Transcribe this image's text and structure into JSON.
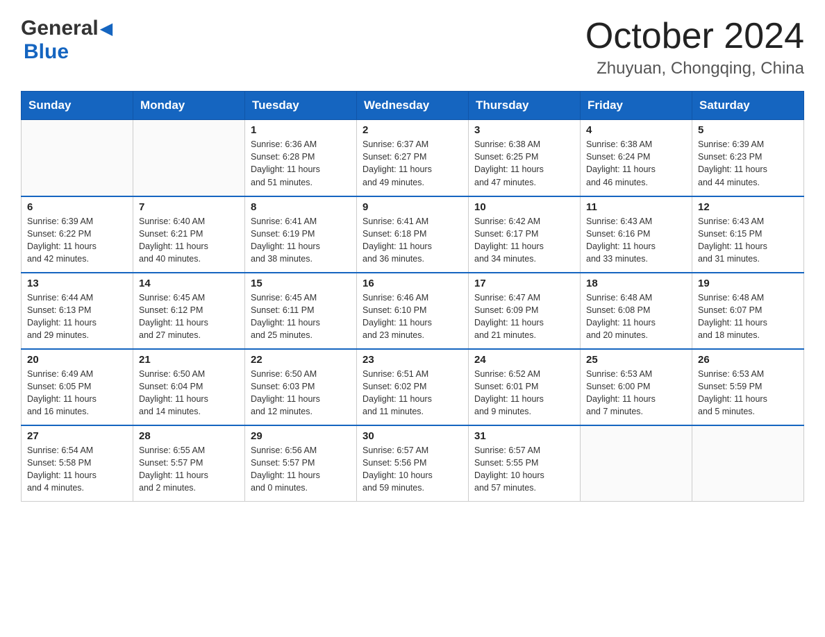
{
  "header": {
    "logo_general": "General",
    "logo_blue": "Blue",
    "month_title": "October 2024",
    "location": "Zhuyuan, Chongqing, China"
  },
  "weekdays": [
    "Sunday",
    "Monday",
    "Tuesday",
    "Wednesday",
    "Thursday",
    "Friday",
    "Saturday"
  ],
  "weeks": [
    {
      "days": [
        {
          "number": "",
          "info": ""
        },
        {
          "number": "",
          "info": ""
        },
        {
          "number": "1",
          "info": "Sunrise: 6:36 AM\nSunset: 6:28 PM\nDaylight: 11 hours\nand 51 minutes."
        },
        {
          "number": "2",
          "info": "Sunrise: 6:37 AM\nSunset: 6:27 PM\nDaylight: 11 hours\nand 49 minutes."
        },
        {
          "number": "3",
          "info": "Sunrise: 6:38 AM\nSunset: 6:25 PM\nDaylight: 11 hours\nand 47 minutes."
        },
        {
          "number": "4",
          "info": "Sunrise: 6:38 AM\nSunset: 6:24 PM\nDaylight: 11 hours\nand 46 minutes."
        },
        {
          "number": "5",
          "info": "Sunrise: 6:39 AM\nSunset: 6:23 PM\nDaylight: 11 hours\nand 44 minutes."
        }
      ]
    },
    {
      "days": [
        {
          "number": "6",
          "info": "Sunrise: 6:39 AM\nSunset: 6:22 PM\nDaylight: 11 hours\nand 42 minutes."
        },
        {
          "number": "7",
          "info": "Sunrise: 6:40 AM\nSunset: 6:21 PM\nDaylight: 11 hours\nand 40 minutes."
        },
        {
          "number": "8",
          "info": "Sunrise: 6:41 AM\nSunset: 6:19 PM\nDaylight: 11 hours\nand 38 minutes."
        },
        {
          "number": "9",
          "info": "Sunrise: 6:41 AM\nSunset: 6:18 PM\nDaylight: 11 hours\nand 36 minutes."
        },
        {
          "number": "10",
          "info": "Sunrise: 6:42 AM\nSunset: 6:17 PM\nDaylight: 11 hours\nand 34 minutes."
        },
        {
          "number": "11",
          "info": "Sunrise: 6:43 AM\nSunset: 6:16 PM\nDaylight: 11 hours\nand 33 minutes."
        },
        {
          "number": "12",
          "info": "Sunrise: 6:43 AM\nSunset: 6:15 PM\nDaylight: 11 hours\nand 31 minutes."
        }
      ]
    },
    {
      "days": [
        {
          "number": "13",
          "info": "Sunrise: 6:44 AM\nSunset: 6:13 PM\nDaylight: 11 hours\nand 29 minutes."
        },
        {
          "number": "14",
          "info": "Sunrise: 6:45 AM\nSunset: 6:12 PM\nDaylight: 11 hours\nand 27 minutes."
        },
        {
          "number": "15",
          "info": "Sunrise: 6:45 AM\nSunset: 6:11 PM\nDaylight: 11 hours\nand 25 minutes."
        },
        {
          "number": "16",
          "info": "Sunrise: 6:46 AM\nSunset: 6:10 PM\nDaylight: 11 hours\nand 23 minutes."
        },
        {
          "number": "17",
          "info": "Sunrise: 6:47 AM\nSunset: 6:09 PM\nDaylight: 11 hours\nand 21 minutes."
        },
        {
          "number": "18",
          "info": "Sunrise: 6:48 AM\nSunset: 6:08 PM\nDaylight: 11 hours\nand 20 minutes."
        },
        {
          "number": "19",
          "info": "Sunrise: 6:48 AM\nSunset: 6:07 PM\nDaylight: 11 hours\nand 18 minutes."
        }
      ]
    },
    {
      "days": [
        {
          "number": "20",
          "info": "Sunrise: 6:49 AM\nSunset: 6:05 PM\nDaylight: 11 hours\nand 16 minutes."
        },
        {
          "number": "21",
          "info": "Sunrise: 6:50 AM\nSunset: 6:04 PM\nDaylight: 11 hours\nand 14 minutes."
        },
        {
          "number": "22",
          "info": "Sunrise: 6:50 AM\nSunset: 6:03 PM\nDaylight: 11 hours\nand 12 minutes."
        },
        {
          "number": "23",
          "info": "Sunrise: 6:51 AM\nSunset: 6:02 PM\nDaylight: 11 hours\nand 11 minutes."
        },
        {
          "number": "24",
          "info": "Sunrise: 6:52 AM\nSunset: 6:01 PM\nDaylight: 11 hours\nand 9 minutes."
        },
        {
          "number": "25",
          "info": "Sunrise: 6:53 AM\nSunset: 6:00 PM\nDaylight: 11 hours\nand 7 minutes."
        },
        {
          "number": "26",
          "info": "Sunrise: 6:53 AM\nSunset: 5:59 PM\nDaylight: 11 hours\nand 5 minutes."
        }
      ]
    },
    {
      "days": [
        {
          "number": "27",
          "info": "Sunrise: 6:54 AM\nSunset: 5:58 PM\nDaylight: 11 hours\nand 4 minutes."
        },
        {
          "number": "28",
          "info": "Sunrise: 6:55 AM\nSunset: 5:57 PM\nDaylight: 11 hours\nand 2 minutes."
        },
        {
          "number": "29",
          "info": "Sunrise: 6:56 AM\nSunset: 5:57 PM\nDaylight: 11 hours\nand 0 minutes."
        },
        {
          "number": "30",
          "info": "Sunrise: 6:57 AM\nSunset: 5:56 PM\nDaylight: 10 hours\nand 59 minutes."
        },
        {
          "number": "31",
          "info": "Sunrise: 6:57 AM\nSunset: 5:55 PM\nDaylight: 10 hours\nand 57 minutes."
        },
        {
          "number": "",
          "info": ""
        },
        {
          "number": "",
          "info": ""
        }
      ]
    }
  ]
}
